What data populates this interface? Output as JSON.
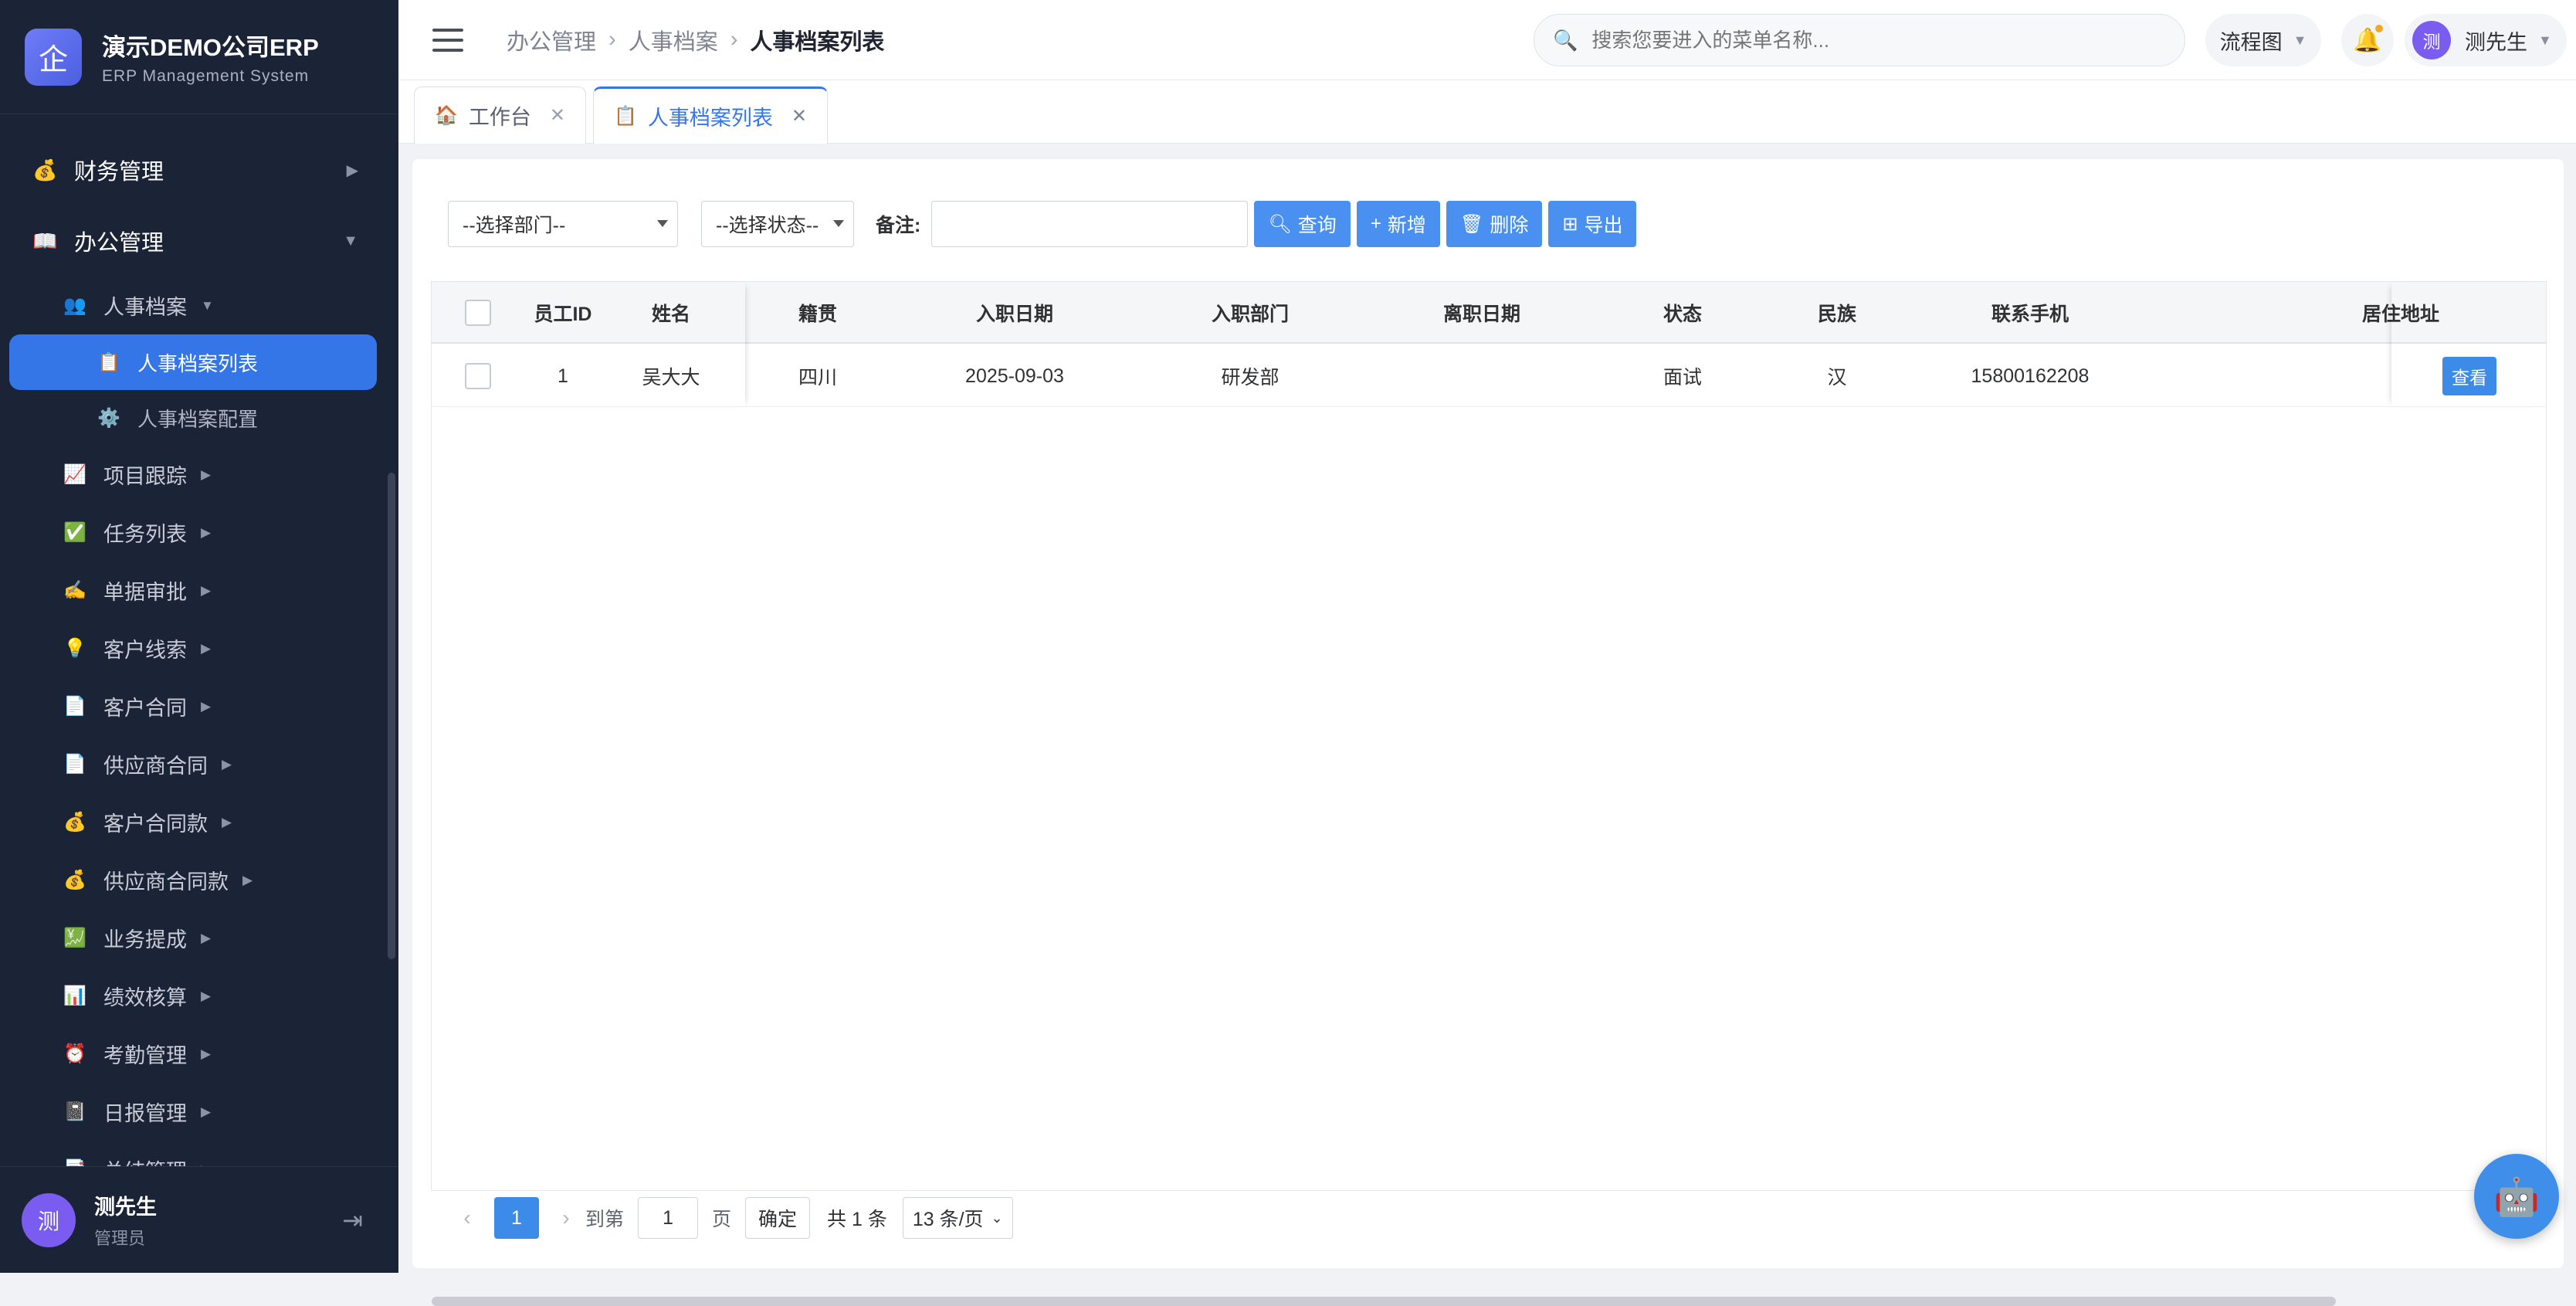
{
  "brand": {
    "logo_char": "企",
    "title": "演示DEMO公司ERP",
    "subtitle": "ERP Management System"
  },
  "sidebar": {
    "groups": [
      {
        "label": "财务管理",
        "icon": "money-bag-icon",
        "glyph": "💰"
      },
      {
        "label": "办公管理",
        "icon": "book-icon",
        "glyph": "📖"
      }
    ],
    "hr": {
      "label": "人事档案",
      "glyph": "👥"
    },
    "hr_leaves": [
      {
        "label": "人事档案列表",
        "glyph": "📋",
        "active": true
      },
      {
        "label": "人事档案配置",
        "glyph": "⚙️",
        "active": false
      }
    ],
    "items": [
      {
        "label": "项目跟踪",
        "glyph": "📈"
      },
      {
        "label": "任务列表",
        "glyph": "✅"
      },
      {
        "label": "单据审批",
        "glyph": "✍️"
      },
      {
        "label": "客户线索",
        "glyph": "💡"
      },
      {
        "label": "客户合同",
        "glyph": "📄"
      },
      {
        "label": "供应商合同",
        "glyph": "📄"
      },
      {
        "label": "客户合同款",
        "glyph": "💰"
      },
      {
        "label": "供应商合同款",
        "glyph": "💰"
      },
      {
        "label": "业务提成",
        "glyph": "💹"
      },
      {
        "label": "绩效核算",
        "glyph": "📊"
      },
      {
        "label": "考勤管理",
        "glyph": "⏰"
      },
      {
        "label": "日报管理",
        "glyph": "📓"
      },
      {
        "label": "总结管理",
        "glyph": "📑"
      }
    ]
  },
  "user": {
    "avatar_char": "测",
    "name": "测先生",
    "role": "管理员"
  },
  "header": {
    "breadcrumb": [
      "办公管理",
      "人事档案",
      "人事档案列表"
    ],
    "search_placeholder": "搜索您要进入的菜单名称...",
    "flow_label": "流程图",
    "user_name": "测先生"
  },
  "tabs": [
    {
      "label": "工作台",
      "glyph": "🏠",
      "active": false
    },
    {
      "label": "人事档案列表",
      "glyph": "📋",
      "active": true
    }
  ],
  "filters": {
    "dept_placeholder": "--选择部门--",
    "status_placeholder": "--选择状态--",
    "remark_label": "备注:",
    "buttons": {
      "query": "查询",
      "add": "新增",
      "delete": "删除",
      "export": "导出"
    }
  },
  "table": {
    "columns": [
      "员工ID",
      "姓名",
      "籍贯",
      "入职日期",
      "入职部门",
      "离职日期",
      "状态",
      "民族",
      "联系手机",
      "居住地址"
    ],
    "rows": [
      {
        "id": "1",
        "name": "吴大大",
        "origin": "四川",
        "join_date": "2025-09-03",
        "dept": "研发部",
        "leave_date": "",
        "status": "面试",
        "ethnicity": "汉",
        "phone": "15800162208",
        "address": "",
        "action": "查看"
      }
    ]
  },
  "pagination": {
    "current_page": "1",
    "goto_label": "到第",
    "goto_value": "1",
    "page_unit": "页",
    "confirm": "确定",
    "total": "共 1 条",
    "page_size": "13 条/页"
  }
}
